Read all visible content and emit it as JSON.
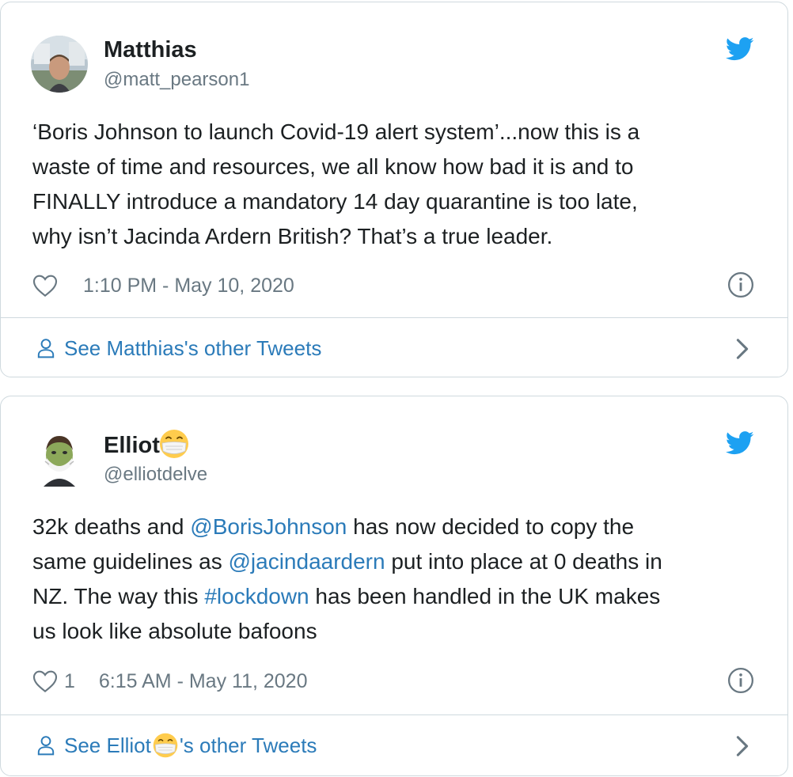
{
  "tweets": [
    {
      "author": {
        "name": "Matthias",
        "handle": "@matt_pearson1"
      },
      "text_lines": [
        "‘Boris Johnson to launch Covid-19 alert system’...now this is a",
        "waste of time and resources, we all know how bad it is and to",
        "FINALLY introduce a mandatory 14 day quarantine is too late,",
        "why isn’t Jacinda Ardern British? That’s a true leader."
      ],
      "like_count": "",
      "timestamp": "1:10 PM - May 10, 2020",
      "see_more_label": "See Matthias's other Tweets"
    },
    {
      "author": {
        "name": "Elliot",
        "handle": "@elliotdelve"
      },
      "text": {
        "l1a": "32k deaths and ",
        "l1_mention": "@BorisJohnson",
        "l1b": " has now decided to copy the",
        "l2a": "same guidelines as ",
        "l2_mention": "@jacindaardern",
        "l2b": " put into place at 0 deaths in",
        "l3a": "NZ. The way this ",
        "l3_hashtag": "#lockdown",
        "l3b": " has been handled in the UK makes",
        "l4": "us look like absolute bafoons"
      },
      "like_count": "1",
      "timestamp": "6:15 AM - May 11, 2020",
      "see_more_prefix": "See Elliot",
      "see_more_suffix": "'s other Tweets"
    }
  ],
  "icons": {
    "twitter_bird": "twitter-bird-icon",
    "heart": "heart-icon",
    "info": "info-icon",
    "person": "person-icon",
    "chevron": "chevron-right-icon",
    "emoji": "medical-mask-emoji-icon"
  },
  "colors": {
    "brand_blue": "#1da1f2",
    "link_blue": "#2b7bb9",
    "muted": "#697882",
    "text": "#1c2022",
    "border": "#cfd9de"
  }
}
